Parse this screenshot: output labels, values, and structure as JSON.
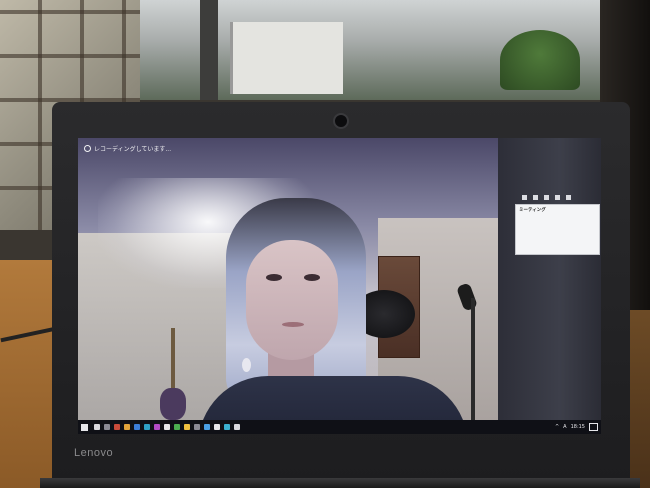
{
  "laptop": {
    "brand": "Lenovo"
  },
  "screen": {
    "recording_indicator": "レコーディングしています...",
    "chat_panel": {
      "title": "ミーティング",
      "lines": [
        "",
        "",
        "",
        "",
        "",
        "",
        "",
        ""
      ]
    },
    "taskbar": {
      "tray_ime": "A",
      "tray_time": "18:15"
    }
  }
}
